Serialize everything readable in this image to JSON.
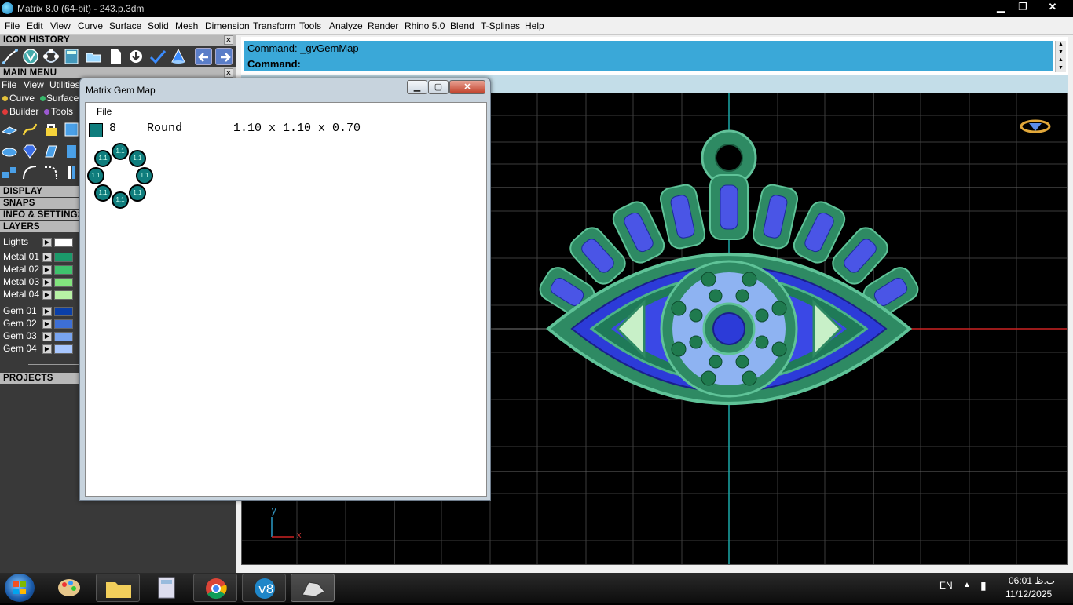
{
  "window": {
    "title": "Matrix 8.0 (64-bit) - 243.p.3dm",
    "controls": [
      "minimize",
      "maximize",
      "close"
    ]
  },
  "menubar": [
    "File",
    "Edit",
    "View",
    "Curve",
    "Surface",
    "Solid",
    "Mesh",
    "Dimension",
    "Transform",
    "Tools",
    "Analyze",
    "Render",
    "Rhino 5.0",
    "Blend",
    "T-Splines",
    "Help"
  ],
  "left_panel": {
    "icon_history": "ICON HISTORY",
    "main_menu": "MAIN MENU",
    "main_menu_items": [
      "File",
      "View",
      "Utilities"
    ],
    "chip_row1": [
      "Curve",
      "Surface"
    ],
    "chip_row2": [
      "Builder",
      "Tools"
    ],
    "sections": [
      "DISPLAY",
      "SNAPS",
      "INFO & SETTINGS",
      "LAYERS"
    ],
    "projects": "PROJECTS",
    "layers": [
      {
        "name": "Lights",
        "color": "#ffffff"
      },
      {
        "name": "Metal 01",
        "color": "#1b9a6a"
      },
      {
        "name": "Metal 02",
        "color": "#3fc36d"
      },
      {
        "name": "Metal 03",
        "color": "#82e47e"
      },
      {
        "name": "Metal 04",
        "color": "#b7f2a5"
      },
      {
        "name": "Gem 01",
        "color": "#0a3fa8"
      },
      {
        "name": "Gem 02",
        "color": "#3d6fd6"
      },
      {
        "name": "Gem 03",
        "color": "#78a4f0"
      },
      {
        "name": "Gem 04",
        "color": "#a8c7ff"
      }
    ]
  },
  "command": {
    "line1": "Command: _gvGemMap",
    "line2": "Command:"
  },
  "gem_map": {
    "title": "Matrix Gem Map",
    "menu_file": "File",
    "row_count": "8",
    "row_shape": "Round",
    "row_size": "1.10 x 1.10 x 0.70",
    "stone_label": "1.1",
    "swatch_color": "#0f7d7d"
  },
  "viewport": {
    "axis_y": "y",
    "axis_x": "x"
  },
  "taskbar": {
    "language": "EN",
    "time": "06:01 ب.ظ",
    "date": "11/12/2025"
  }
}
